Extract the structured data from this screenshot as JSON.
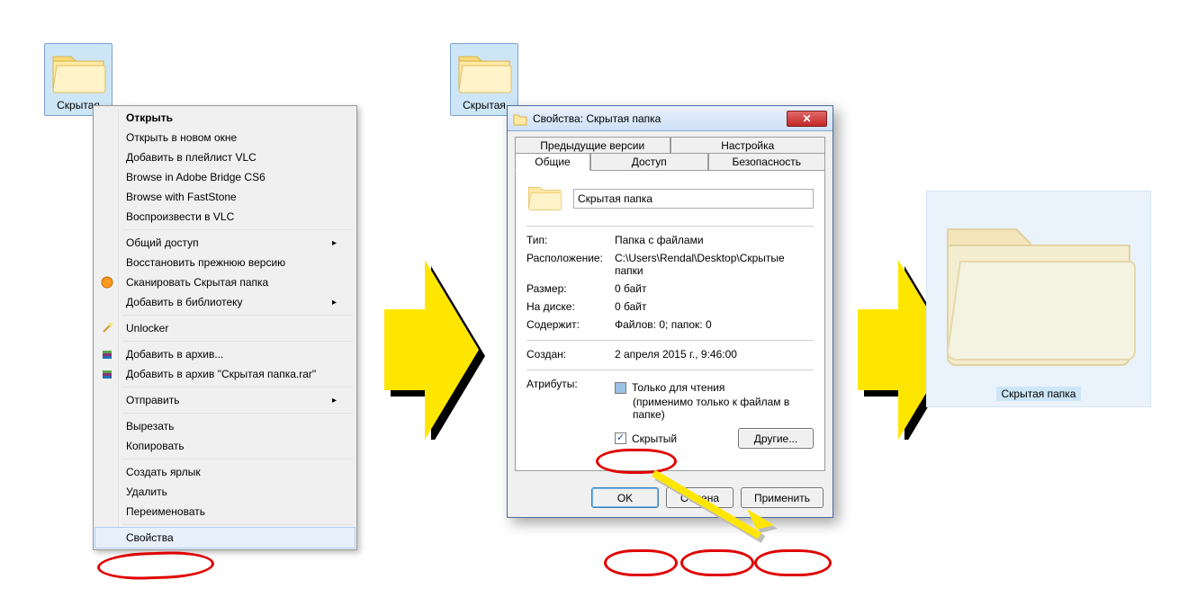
{
  "folder_small_1": {
    "label": "Скрытая"
  },
  "folder_small_2": {
    "label": "Скрытая"
  },
  "folder_large": {
    "label": "Скрытая папка"
  },
  "ctx": {
    "open": "Открыть",
    "open_new": "Открыть в новом окне",
    "vlc_playlist": "Добавить в плейлист VLC",
    "bridge": "Browse in Adobe Bridge CS6",
    "faststone": "Browse with FastStone",
    "vlc_play": "Воспроизвести в VLC",
    "share": "Общий доступ",
    "restore": "Восстановить прежнюю версию",
    "scan": "Сканировать Скрытая папка",
    "library": "Добавить в библиотеку",
    "unlocker": "Unlocker",
    "rar_add": "Добавить в архив...",
    "rar_add_named": "Добавить в архив \"Скрытая папка.rar\"",
    "send": "Отправить",
    "cut": "Вырезать",
    "copy": "Копировать",
    "shortcut": "Создать ярлык",
    "delete": "Удалить",
    "rename": "Переименовать",
    "props": "Свойства"
  },
  "dlg": {
    "title": "Свойства: Скрытая папка",
    "tabs": {
      "prev": "Предыдущие версии",
      "customize": "Настройка",
      "general": "Общие",
      "access": "Доступ",
      "security": "Безопасность"
    },
    "name_value": "Скрытая папка",
    "type_k": "Тип:",
    "type_v": "Папка с файлами",
    "loc_k": "Расположение:",
    "loc_v": "C:\\Users\\Rendal\\Desktop\\Скрытые папки",
    "size_k": "Размер:",
    "size_v": "0 байт",
    "ondisk_k": "На диске:",
    "ondisk_v": "0 байт",
    "contains_k": "Содержит:",
    "contains_v": "Файлов: 0; папок: 0",
    "created_k": "Создан:",
    "created_v": "2 апреля 2015 г., 9:46:00",
    "attrs_k": "Атрибуты:",
    "readonly": "Только для чтения",
    "readonly_sub": "(применимо только к файлам в папке)",
    "hidden": "Скрытый",
    "other_btn": "Другие...",
    "ok": "OK",
    "cancel": "Отмена",
    "apply": "Применить"
  }
}
